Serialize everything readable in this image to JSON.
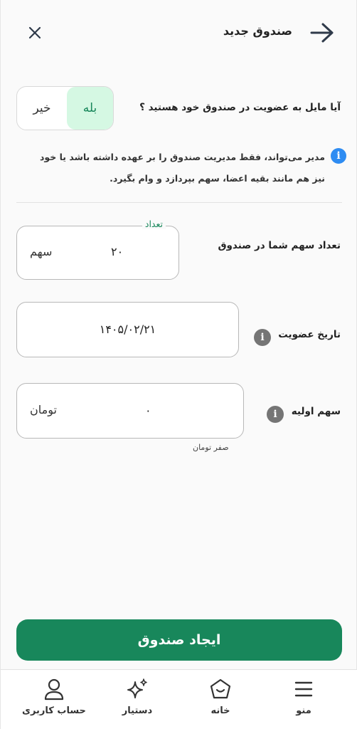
{
  "header": {
    "title": "صندوق جدید"
  },
  "membership": {
    "question": "آیا مایل به عضویت در صندوق خود هستید ؟",
    "yes_label": "بله",
    "no_label": "خیر",
    "info_text": "مدیر می‌تواند، فقط مدیریت صندوق را بر عهده داشته باشد یا خود نیز هم مانند بقیه اعضا، سهم بپردازد و وام بگیرد."
  },
  "shares": {
    "label": "تعداد سهم شما در صندوق",
    "floating_label": "تعداد",
    "value": "۲۰",
    "unit": "سهم"
  },
  "membership_date": {
    "label": "تاریخ عضویت",
    "value": "۱۴۰۵/۰۲/۲۱"
  },
  "initial_share": {
    "label": "سهم اولیه",
    "value": "۰",
    "unit": "تومان",
    "helper": "صفر تومان"
  },
  "submit": {
    "label": "ایجاد صندوق"
  },
  "bottom_nav": {
    "menu": "منو",
    "home": "خانه",
    "assistant": "دستیار",
    "account": "حساب کاربری"
  },
  "colors": {
    "primary": "#18875b",
    "toggle_selected_bg": "#d5f8e3",
    "info_blue": "#2e8cf2",
    "info_grey": "#757575"
  }
}
